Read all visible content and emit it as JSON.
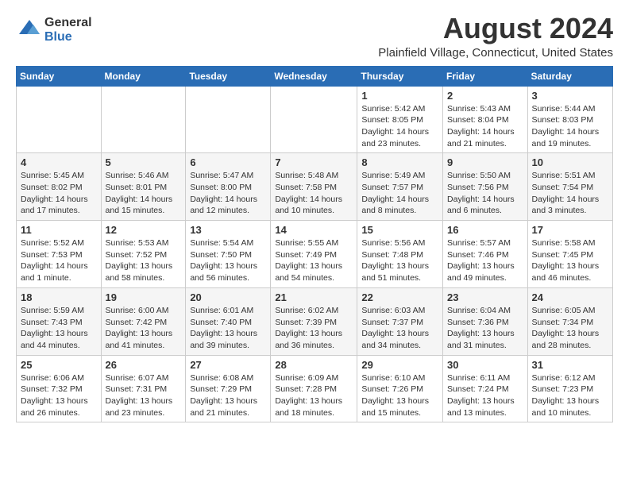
{
  "header": {
    "logo_line1": "General",
    "logo_line2": "Blue",
    "month_year": "August 2024",
    "location": "Plainfield Village, Connecticut, United States"
  },
  "weekdays": [
    "Sunday",
    "Monday",
    "Tuesday",
    "Wednesday",
    "Thursday",
    "Friday",
    "Saturday"
  ],
  "weeks": [
    [
      {
        "day": "",
        "info": ""
      },
      {
        "day": "",
        "info": ""
      },
      {
        "day": "",
        "info": ""
      },
      {
        "day": "",
        "info": ""
      },
      {
        "day": "1",
        "info": "Sunrise: 5:42 AM\nSunset: 8:05 PM\nDaylight: 14 hours\nand 23 minutes."
      },
      {
        "day": "2",
        "info": "Sunrise: 5:43 AM\nSunset: 8:04 PM\nDaylight: 14 hours\nand 21 minutes."
      },
      {
        "day": "3",
        "info": "Sunrise: 5:44 AM\nSunset: 8:03 PM\nDaylight: 14 hours\nand 19 minutes."
      }
    ],
    [
      {
        "day": "4",
        "info": "Sunrise: 5:45 AM\nSunset: 8:02 PM\nDaylight: 14 hours\nand 17 minutes."
      },
      {
        "day": "5",
        "info": "Sunrise: 5:46 AM\nSunset: 8:01 PM\nDaylight: 14 hours\nand 15 minutes."
      },
      {
        "day": "6",
        "info": "Sunrise: 5:47 AM\nSunset: 8:00 PM\nDaylight: 14 hours\nand 12 minutes."
      },
      {
        "day": "7",
        "info": "Sunrise: 5:48 AM\nSunset: 7:58 PM\nDaylight: 14 hours\nand 10 minutes."
      },
      {
        "day": "8",
        "info": "Sunrise: 5:49 AM\nSunset: 7:57 PM\nDaylight: 14 hours\nand 8 minutes."
      },
      {
        "day": "9",
        "info": "Sunrise: 5:50 AM\nSunset: 7:56 PM\nDaylight: 14 hours\nand 6 minutes."
      },
      {
        "day": "10",
        "info": "Sunrise: 5:51 AM\nSunset: 7:54 PM\nDaylight: 14 hours\nand 3 minutes."
      }
    ],
    [
      {
        "day": "11",
        "info": "Sunrise: 5:52 AM\nSunset: 7:53 PM\nDaylight: 14 hours\nand 1 minute."
      },
      {
        "day": "12",
        "info": "Sunrise: 5:53 AM\nSunset: 7:52 PM\nDaylight: 13 hours\nand 58 minutes."
      },
      {
        "day": "13",
        "info": "Sunrise: 5:54 AM\nSunset: 7:50 PM\nDaylight: 13 hours\nand 56 minutes."
      },
      {
        "day": "14",
        "info": "Sunrise: 5:55 AM\nSunset: 7:49 PM\nDaylight: 13 hours\nand 54 minutes."
      },
      {
        "day": "15",
        "info": "Sunrise: 5:56 AM\nSunset: 7:48 PM\nDaylight: 13 hours\nand 51 minutes."
      },
      {
        "day": "16",
        "info": "Sunrise: 5:57 AM\nSunset: 7:46 PM\nDaylight: 13 hours\nand 49 minutes."
      },
      {
        "day": "17",
        "info": "Sunrise: 5:58 AM\nSunset: 7:45 PM\nDaylight: 13 hours\nand 46 minutes."
      }
    ],
    [
      {
        "day": "18",
        "info": "Sunrise: 5:59 AM\nSunset: 7:43 PM\nDaylight: 13 hours\nand 44 minutes."
      },
      {
        "day": "19",
        "info": "Sunrise: 6:00 AM\nSunset: 7:42 PM\nDaylight: 13 hours\nand 41 minutes."
      },
      {
        "day": "20",
        "info": "Sunrise: 6:01 AM\nSunset: 7:40 PM\nDaylight: 13 hours\nand 39 minutes."
      },
      {
        "day": "21",
        "info": "Sunrise: 6:02 AM\nSunset: 7:39 PM\nDaylight: 13 hours\nand 36 minutes."
      },
      {
        "day": "22",
        "info": "Sunrise: 6:03 AM\nSunset: 7:37 PM\nDaylight: 13 hours\nand 34 minutes."
      },
      {
        "day": "23",
        "info": "Sunrise: 6:04 AM\nSunset: 7:36 PM\nDaylight: 13 hours\nand 31 minutes."
      },
      {
        "day": "24",
        "info": "Sunrise: 6:05 AM\nSunset: 7:34 PM\nDaylight: 13 hours\nand 28 minutes."
      }
    ],
    [
      {
        "day": "25",
        "info": "Sunrise: 6:06 AM\nSunset: 7:32 PM\nDaylight: 13 hours\nand 26 minutes."
      },
      {
        "day": "26",
        "info": "Sunrise: 6:07 AM\nSunset: 7:31 PM\nDaylight: 13 hours\nand 23 minutes."
      },
      {
        "day": "27",
        "info": "Sunrise: 6:08 AM\nSunset: 7:29 PM\nDaylight: 13 hours\nand 21 minutes."
      },
      {
        "day": "28",
        "info": "Sunrise: 6:09 AM\nSunset: 7:28 PM\nDaylight: 13 hours\nand 18 minutes."
      },
      {
        "day": "29",
        "info": "Sunrise: 6:10 AM\nSunset: 7:26 PM\nDaylight: 13 hours\nand 15 minutes."
      },
      {
        "day": "30",
        "info": "Sunrise: 6:11 AM\nSunset: 7:24 PM\nDaylight: 13 hours\nand 13 minutes."
      },
      {
        "day": "31",
        "info": "Sunrise: 6:12 AM\nSunset: 7:23 PM\nDaylight: 13 hours\nand 10 minutes."
      }
    ]
  ]
}
